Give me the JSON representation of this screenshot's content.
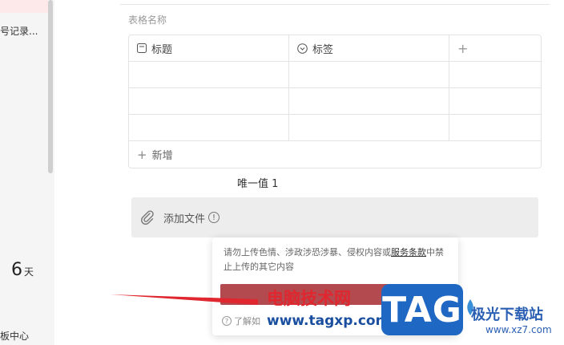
{
  "sidebar": {
    "item_text": "号记录...",
    "days_number": "6",
    "days_unit": "天",
    "bottom_text": "板中心"
  },
  "table": {
    "title": "表格名称",
    "col1_header": "标题",
    "col2_header": "标签",
    "add_column": "+",
    "add_row_plus": "+",
    "add_row_label": "新增"
  },
  "unique_value": "唯一值 1",
  "attach": {
    "label": "添加文件",
    "info_glyph": "!"
  },
  "popup": {
    "message_part1": "请勿上传色情、涉政涉恐涉暴、侵权内容或",
    "message_link": "服务条款",
    "message_part2": "中禁止上传的其它内容",
    "help_glyph": "?",
    "help_label": "了解如"
  },
  "watermark": {
    "site_name": "电脑技术网",
    "url": "www.tagxp.com",
    "tag_text": "TAG",
    "brand_cn": "极光下载站",
    "brand_url": "www.xz7.com"
  },
  "colors": {
    "upload_button": "#b24a4f",
    "arrow": "#e0262e",
    "tag_badge": "#1e67c2"
  }
}
